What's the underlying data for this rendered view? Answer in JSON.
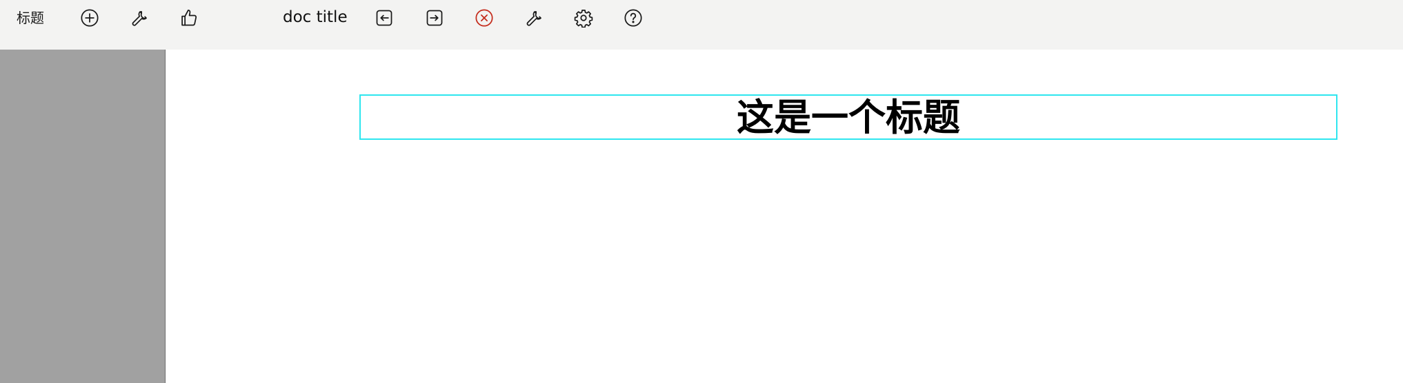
{
  "toolbar": {
    "app_title": "标题",
    "doc_title": "doc title",
    "left_icons": [
      "add-circle-icon",
      "wrench-icon",
      "thumbs-up-icon"
    ],
    "right_icons": [
      "import-icon",
      "export-icon",
      "close-circle-icon",
      "wrench-icon",
      "settings-gear-icon",
      "help-icon"
    ],
    "close_color": "#c42b1c"
  },
  "document": {
    "heading": "这是一个标题",
    "heading_border_color": "#2ee6ef"
  },
  "panel": {
    "background": "#a1a1a1"
  }
}
